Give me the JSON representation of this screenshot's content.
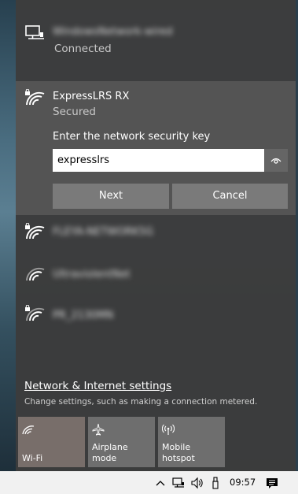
{
  "networks": {
    "connected": {
      "name": "WindowsNetwork-wired",
      "status": "Connected",
      "icon": "wired-monitor-icon"
    },
    "selected": {
      "name": "ExpressLRS RX",
      "status": "Secured",
      "icon": "wifi-secured-icon",
      "key_prompt": "Enter the network security key",
      "key_value": "expresslrs",
      "next_label": "Next",
      "cancel_label": "Cancel"
    },
    "others": [
      {
        "name": "FLEYA-NETWORK5G",
        "icon": "wifi-secured-icon"
      },
      {
        "name": "UltraviolentNet",
        "icon": "wifi-icon"
      },
      {
        "name": "PR_2130MN",
        "icon": "wifi-secured-icon"
      }
    ]
  },
  "settings": {
    "link": "Network & Internet settings",
    "description": "Change settings, such as making a connection metered."
  },
  "quick_actions": [
    {
      "label": "Wi-Fi",
      "icon": "wifi-icon",
      "active": true
    },
    {
      "label": "Airplane mode",
      "icon": "airplane-icon",
      "active": false
    },
    {
      "label": "Mobile hotspot",
      "icon": "hotspot-icon",
      "active": false
    }
  ],
  "taskbar": {
    "time": "09:57"
  }
}
